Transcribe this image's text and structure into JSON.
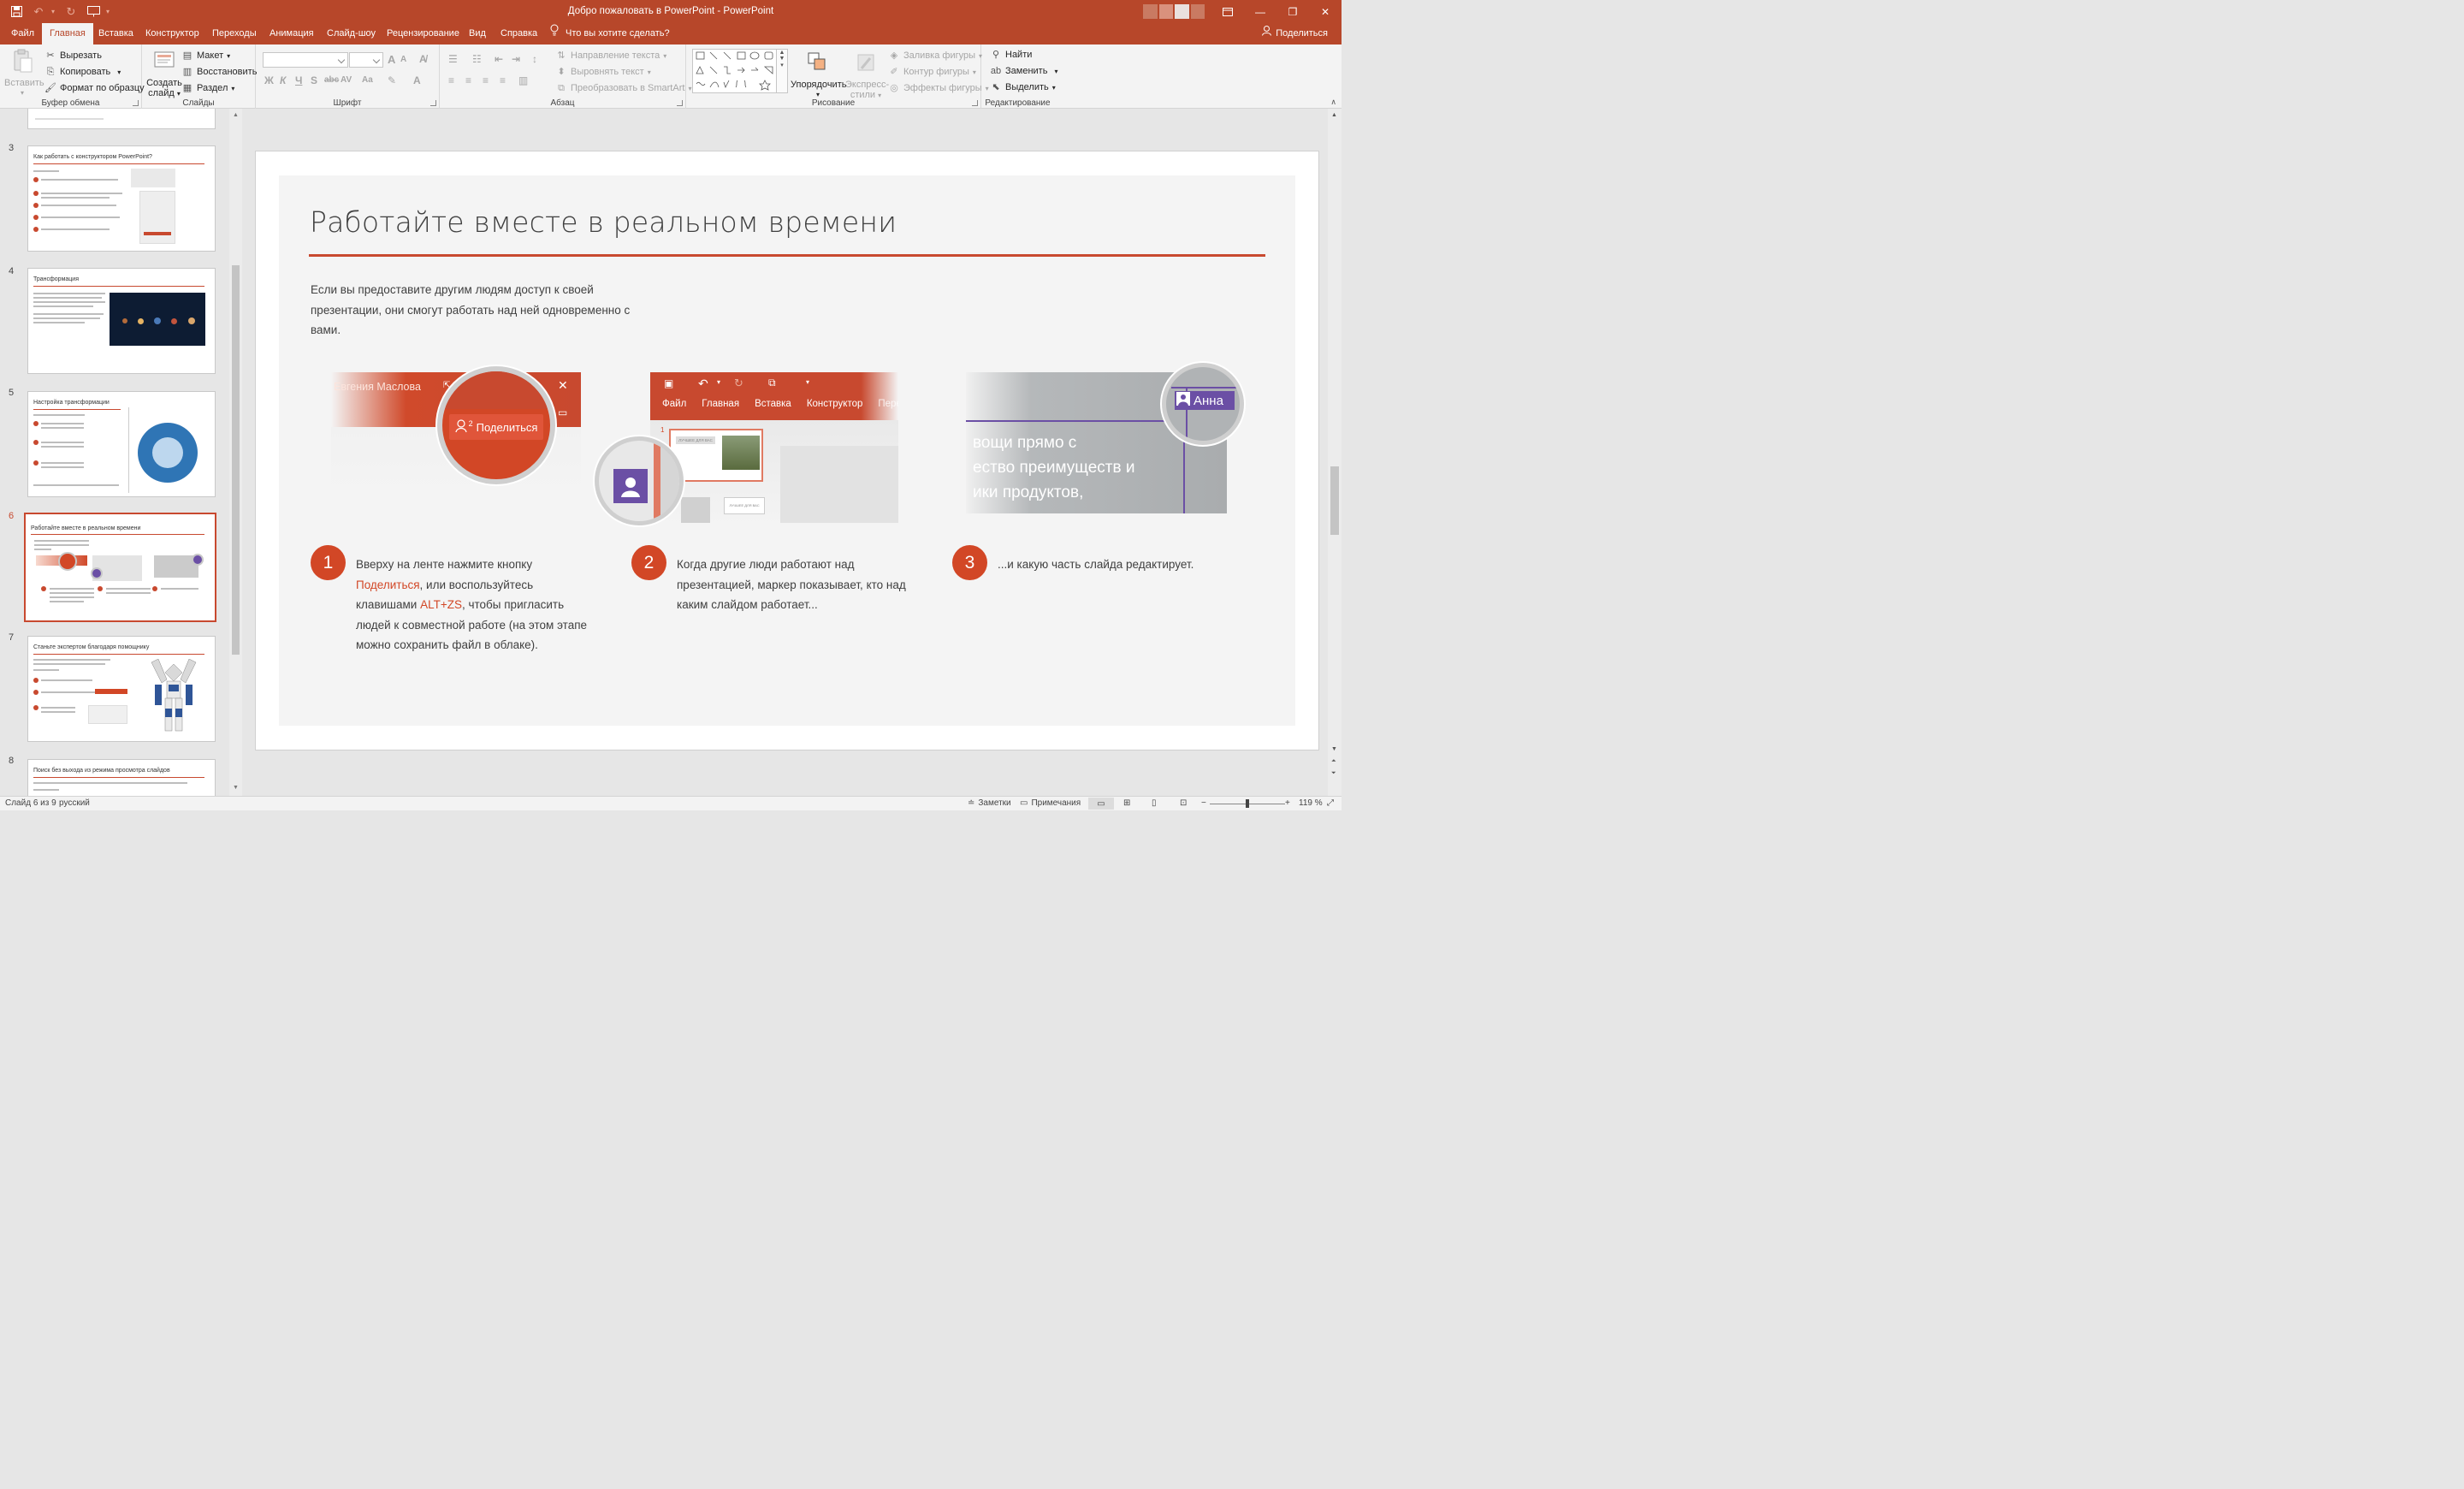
{
  "window": {
    "title": "Добро пожаловать в PowerPoint  -  PowerPoint"
  },
  "menu": {
    "tabs": [
      "Файл",
      "Главная",
      "Вставка",
      "Конструктор",
      "Переходы",
      "Анимация",
      "Слайд-шоу",
      "Рецензирование",
      "Вид",
      "Справка"
    ],
    "active_tab": "Главная",
    "tell_me": "Что вы хотите сделать?",
    "share": "Поделиться"
  },
  "ribbon": {
    "clipboard": {
      "label": "Буфер обмена",
      "paste": "Вставить",
      "cut": "Вырезать",
      "copy": "Копировать",
      "format_painter": "Формат по образцу"
    },
    "slides": {
      "label": "Слайды",
      "new_slide_1": "Создать",
      "new_slide_2": "слайд",
      "layout": "Макет",
      "reset": "Восстановить",
      "section": "Раздел"
    },
    "font": {
      "label": "Шрифт",
      "bold": "Ж",
      "italic": "К",
      "underline": "Ч",
      "strike": "S",
      "abc": "abc",
      "spacing": "AV",
      "case": "Aa",
      "grow": "A",
      "shrink": "A"
    },
    "paragraph": {
      "label": "Абзац",
      "text_direction": "Направление текста",
      "align_text": "Выровнять текст",
      "smartart": "Преобразовать в SmartArt"
    },
    "drawing": {
      "label": "Рисование",
      "arrange": "Упорядочить",
      "quick_styles_1": "Экспресс-",
      "quick_styles_2": "стили",
      "shape_fill": "Заливка фигуры",
      "shape_outline": "Контур фигуры",
      "shape_effects": "Эффекты фигуры"
    },
    "editing": {
      "label": "Редактирование",
      "find": "Найти",
      "replace": "Заменить",
      "select": "Выделить"
    }
  },
  "thumbnails": [
    {
      "num": "3",
      "title": "Как работать с конструктором PowerPoint?"
    },
    {
      "num": "4",
      "title": "Трансформация"
    },
    {
      "num": "5",
      "title": "Настройка трансформации"
    },
    {
      "num": "6",
      "title": "Работайте вместе в реальном времени",
      "selected": true
    },
    {
      "num": "7",
      "title": "Станьте экспертом благодаря помощнику"
    },
    {
      "num": "8",
      "title": "Поиск без выхода из режима просмотра слайдов"
    }
  ],
  "slide": {
    "title": "Работайте вместе в реальном времени",
    "intro_1": "Если вы предоставите другим людям доступ к своей",
    "intro_2": "презентации, они смогут работать над ней одновременно с",
    "intro_3": "вами.",
    "illus1": {
      "user": "Евгения Маслова",
      "share_button": "Поделиться",
      "badge": "2"
    },
    "illus2": {
      "menu": [
        "Файл",
        "Главная",
        "Вставка",
        "Конструктор",
        "Перехо"
      ],
      "thumb_num": "1",
      "thumb_label": "ЛУЧШЕЕ ДЛЯ ВАС"
    },
    "illus3": {
      "user": "Анна",
      "text_1": "вощи прямо с",
      "text_2": "ество преимуществ и",
      "text_3": "ики продуктов,"
    },
    "steps": [
      {
        "num": "1",
        "line1": "Вверху на ленте нажмите кнопку",
        "line2_hl": "Поделиться",
        "line2_rest": ", или воспользуйтесь",
        "line3_pre": "клавишами ",
        "line3_hl": "ALT+ZS",
        "line3_rest": ", чтобы пригласить",
        "line4": "людей к совместной работе (на этом этапе",
        "line5": "можно сохранить файл в облаке)."
      },
      {
        "num": "2",
        "line1": "Когда другие люди работают над",
        "line2": "презентацией, маркер показывает, кто над",
        "line3": "каким слайдом работает..."
      },
      {
        "num": "3",
        "line1": "...и какую часть слайда редактирует."
      }
    ]
  },
  "status": {
    "slide_info": "Слайд 6 из 9",
    "language": "русский",
    "notes": "Заметки",
    "comments": "Примечания",
    "zoom": "119 %"
  },
  "colors": {
    "accent": "#b7472a",
    "slide_accent": "#d24726",
    "purple": "#6b4fa5"
  }
}
